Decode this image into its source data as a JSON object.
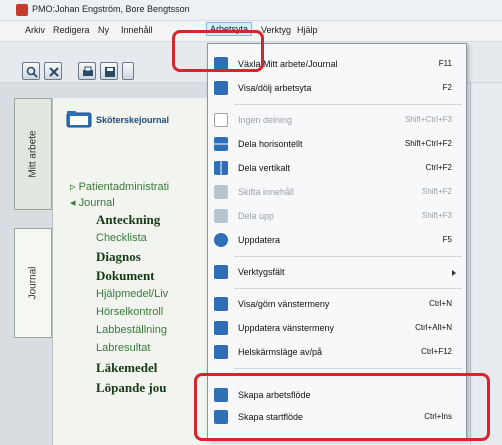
{
  "window": {
    "title": "PMO:Johan Engström, Bore Bengtsson"
  },
  "menubar": {
    "items": [
      "Arkiv",
      "Redigera",
      "Ny",
      "Innehåll",
      "Arbetsyta",
      "Verktyg",
      "Hjälp"
    ],
    "active": "Arbetsyta"
  },
  "sidetabs": {
    "mitt_arbete": "Mitt arbete",
    "journal": "Journal"
  },
  "nav": {
    "header": "Sköterskejournal",
    "tree": [
      {
        "label": "▹ Patientadministrati",
        "style": "small"
      },
      {
        "label": "◂ Journal",
        "style": "small"
      },
      {
        "label": "Anteckning",
        "style": "bold"
      },
      {
        "label": "Checklista",
        "style": "normal"
      },
      {
        "label": "Diagnos",
        "style": "bold"
      },
      {
        "label": "Dokument",
        "style": "bold"
      },
      {
        "label": "Hjälpmedel/Liv",
        "style": "normal"
      },
      {
        "label": "Hörselkontroll",
        "style": "normal"
      },
      {
        "label": "Labbeställning",
        "style": "normal"
      },
      {
        "label": "Labresultat",
        "style": "normal"
      },
      {
        "label": "Läkemedel",
        "style": "bold"
      },
      {
        "label": "Löpande jou",
        "style": "bold"
      }
    ]
  },
  "dropdown": {
    "items": [
      {
        "label": "Växla Mitt arbete/Journal",
        "shortcut": "F11",
        "icon": "swap-workspace-icon",
        "disabled": false
      },
      {
        "label": "Visa/dölj arbetsyta",
        "shortcut": "F2",
        "icon": "toggle-workspace-icon",
        "disabled": false
      },
      {
        "label": "Ingen delning",
        "shortcut": "Shift+Ctrl+F3",
        "icon": "no-split-icon",
        "disabled": true
      },
      {
        "label": "Dela horisontellt",
        "shortcut": "Shift+Ctrl+F2",
        "icon": "split-horizontal-icon",
        "disabled": false
      },
      {
        "label": "Dela vertikalt",
        "shortcut": "Ctrl+F2",
        "icon": "split-vertical-icon",
        "disabled": false
      },
      {
        "label": "Skifta innehåll",
        "shortcut": "Shift+F2",
        "icon": "swap-content-icon",
        "disabled": true
      },
      {
        "label": "Dela upp",
        "shortcut": "Shift+F3",
        "icon": "split-up-icon",
        "disabled": true
      },
      {
        "label": "Uppdatera",
        "shortcut": "F5",
        "icon": "refresh-icon",
        "disabled": false
      },
      {
        "label": "Verktygsfält",
        "shortcut": "",
        "icon": "toolbar-icon",
        "disabled": false,
        "submenu": true
      },
      {
        "label": "Visa/göm vänstermeny",
        "shortcut": "Ctrl+N",
        "icon": "left-menu-icon",
        "disabled": false
      },
      {
        "label": "Uppdatera vänstermeny",
        "shortcut": "Ctrl+Alt+N",
        "icon": "refresh-menu-icon",
        "disabled": false
      },
      {
        "label": "Helskärmsläge av/på",
        "shortcut": "Ctrl+F12",
        "icon": "fullscreen-icon",
        "disabled": false
      },
      {
        "label": "Skapa arbetsflöde",
        "shortcut": "",
        "icon": "create-workflow-icon",
        "disabled": false
      },
      {
        "label": "Skapa startflöde",
        "shortcut": "Ctrl+Ins",
        "icon": "create-startflow-icon",
        "disabled": false
      }
    ]
  },
  "colors": {
    "highlight": "#d6262a",
    "accent": "#2f6fb5",
    "tree_text": "#2a6a2a"
  }
}
